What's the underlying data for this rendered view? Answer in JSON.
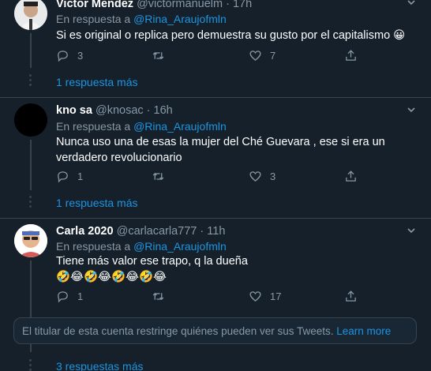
{
  "reply_prefix": "En respuesta a",
  "tweets": [
    {
      "name": "Victor Mendez",
      "handle": "@victormanuelm",
      "time": "17h",
      "reply_to": "@Rina_Araujofmln",
      "text": "Si es original o replica pero demuestra su gusto por el capitalismo 😀",
      "replies": "3",
      "retweets": "",
      "likes": "7",
      "more_replies": "1 respuesta más"
    },
    {
      "name": "kno sa",
      "handle": "@knosac",
      "time": "16h",
      "reply_to": "@Rina_Araujofmln",
      "text": "Nunca uso una de esas la mujer del Ché Guevara , ese si era un verdadero revolucionario",
      "replies": "1",
      "retweets": "",
      "likes": "3",
      "more_replies": "1 respuesta más"
    },
    {
      "name": "Carla 2020",
      "handle": "@carlacarla777",
      "time": "11h",
      "reply_to": "@Rina_Araujofmln",
      "text_line1": "Tiene más valor ese trapo, q la dueña",
      "text_line2": "🤣😂🤣😂🤣😂🤣😂",
      "replies": "1",
      "retweets": "",
      "likes": "17",
      "more_replies": "3 respuestas más"
    }
  ],
  "notice": {
    "text": "El titular de esta cuenta restringe quiénes pueden ver sus Tweets.",
    "link": "Learn more"
  },
  "colors": {
    "background": "#15202b",
    "secondary_text": "#8899a6",
    "link": "#1b95e0",
    "divider": "#38444d"
  },
  "icons": [
    "reply-icon",
    "retweet-icon",
    "like-icon",
    "share-icon",
    "chevron-down-icon"
  ]
}
